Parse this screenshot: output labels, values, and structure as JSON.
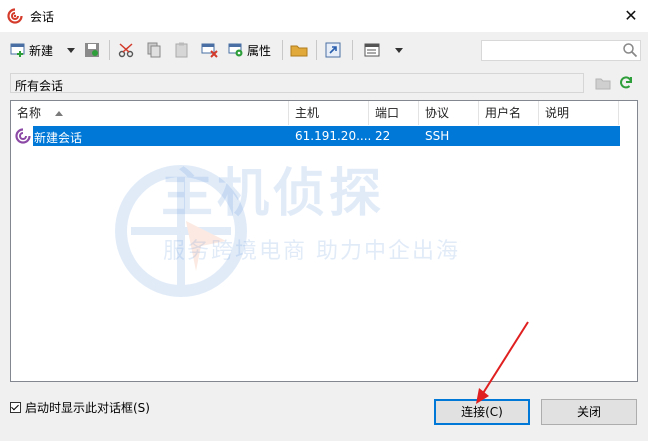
{
  "window": {
    "title": "会话",
    "close_glyph": "✕"
  },
  "toolbar": {
    "new_label": "新建",
    "properties_label": "属性"
  },
  "search": {
    "placeholder": "",
    "value": ""
  },
  "path": {
    "text": "所有会话"
  },
  "table": {
    "columns": [
      "名称",
      "主机",
      "端口",
      "协议",
      "用户名",
      "说明"
    ],
    "rows": [
      {
        "name": "新建会话",
        "host": "61.191.20....",
        "port": "22",
        "protocol": "SSH",
        "user": "",
        "desc": ""
      }
    ]
  },
  "watermark": {
    "line1": "主机侦探",
    "line2": "服务跨境电商 助力中企出海"
  },
  "footer": {
    "startup_checkbox_label": "启动时显示此对话框(S)",
    "startup_checked": true,
    "connect_label": "连接(C)",
    "close_label": "关闭"
  },
  "colors": {
    "selection": "#0078d7",
    "accent_arrow": "#e02020"
  }
}
